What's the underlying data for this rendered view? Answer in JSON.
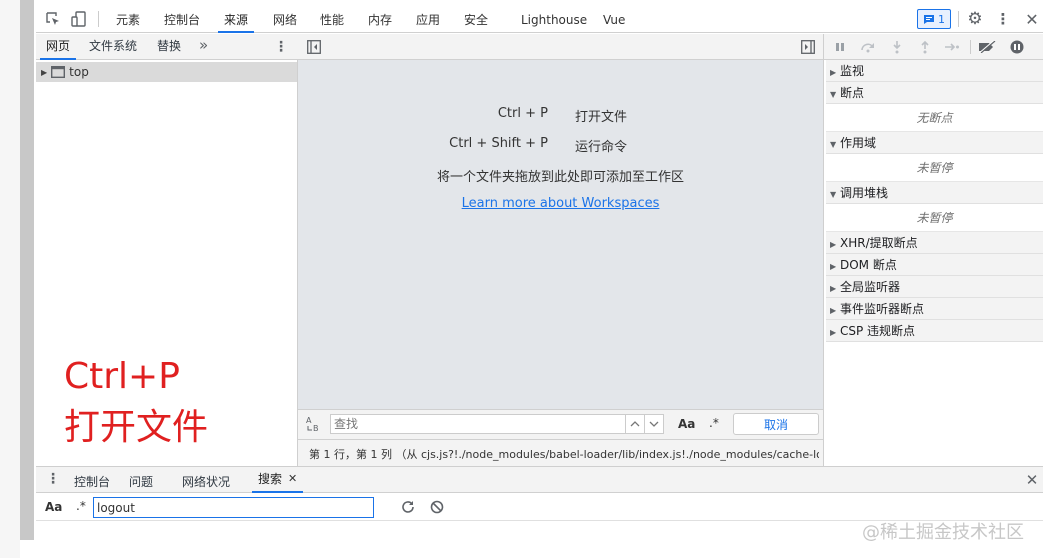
{
  "main_tabs": [
    "元素",
    "控制台",
    "来源",
    "网络",
    "性能",
    "内存",
    "应用",
    "安全",
    "Lighthouse",
    "Vue"
  ],
  "issue_count": "1",
  "navigator": {
    "tabs": [
      "网页",
      "文件系统",
      "替换"
    ],
    "more": "»",
    "tree_item": "top"
  },
  "editor": {
    "shortcuts": [
      {
        "key": "Ctrl + P",
        "label": "打开文件"
      },
      {
        "key": "Ctrl + Shift + P",
        "label": "运行命令"
      }
    ],
    "drop_hint": "将一个文件夹拖放到此处即可添加至工作区",
    "learn_more": "Learn more about Workspaces"
  },
  "find": {
    "placeholder": "查找",
    "case_label": "Aa",
    "regex_label": ".*",
    "cancel_label": "取消"
  },
  "status_bar": "第 1 行，第 1 列 （从 cjs.js?!./node_modules/babel-loader/lib/index.js!./node_modules/cache-lo",
  "debugger": {
    "sections": [
      {
        "label": "监视",
        "expanded": false
      },
      {
        "label": "断点",
        "expanded": true,
        "empty": "无断点"
      },
      {
        "label": "作用域",
        "expanded": true,
        "empty": "未暂停"
      },
      {
        "label": "调用堆栈",
        "expanded": true,
        "empty": "未暂停"
      },
      {
        "label": "XHR/提取断点",
        "expanded": false
      },
      {
        "label": "DOM 断点",
        "expanded": false
      },
      {
        "label": "全局监听器",
        "expanded": false
      },
      {
        "label": "事件监听器断点",
        "expanded": false
      },
      {
        "label": "CSP 违规断点",
        "expanded": false
      }
    ]
  },
  "annotation": {
    "line1": "Ctrl+P",
    "line2": "打开文件"
  },
  "drawer": {
    "tabs": [
      "控制台",
      "问题",
      "网络状况",
      "搜索"
    ],
    "case_label": "Aa",
    "regex_label": ".*",
    "search_value": "logout"
  },
  "watermark": "@稀土掘金技术社区",
  "colors": {
    "accent": "#1a73e8",
    "annotation_red": "#e02020",
    "editor_bg": "#e3e6ea",
    "panel_bg": "#f3f3f3"
  }
}
